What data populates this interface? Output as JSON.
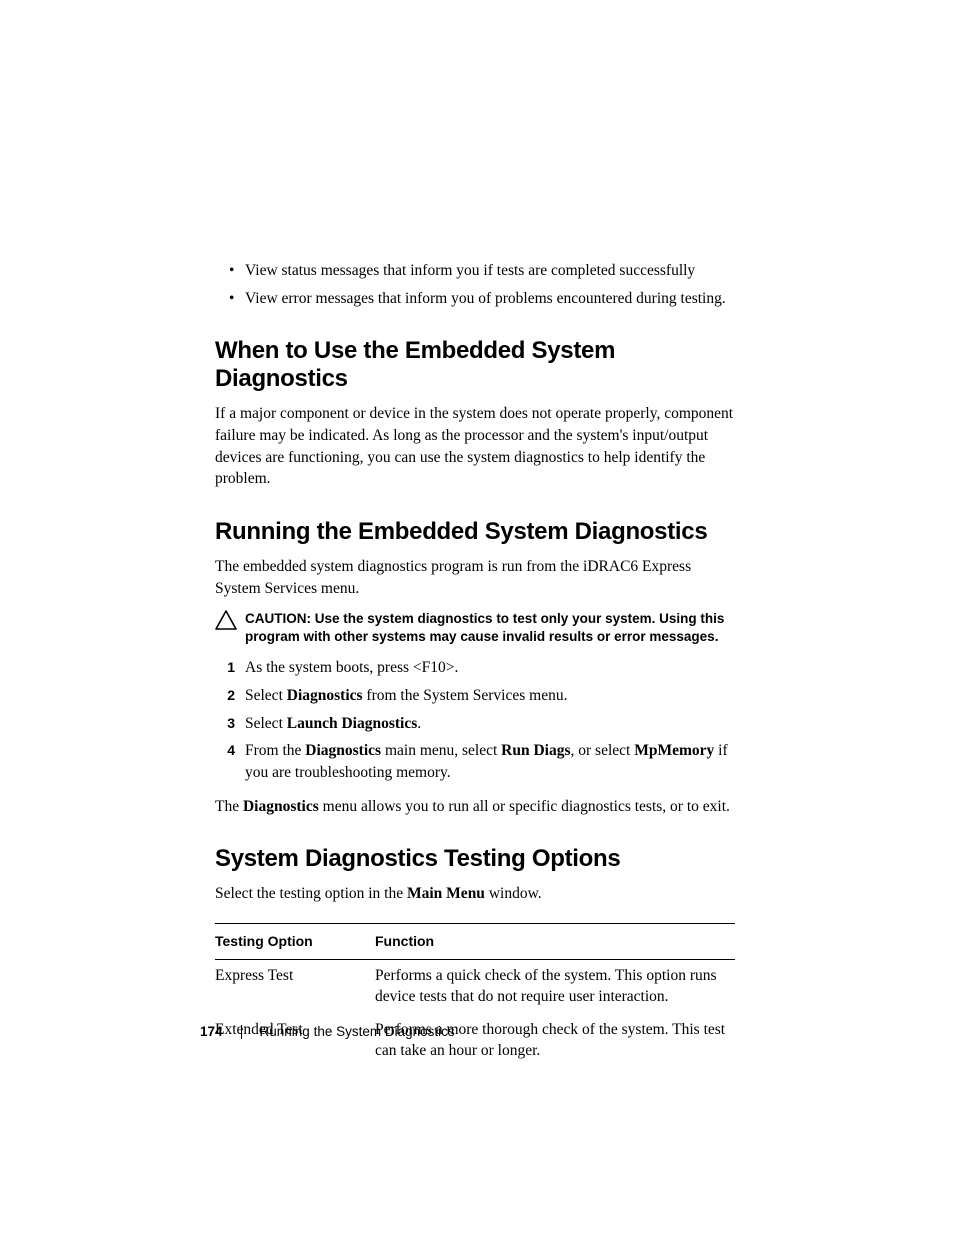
{
  "top_bullets": [
    "View status messages that inform you if tests are completed successfully",
    "View error messages that inform you of problems encountered during testing."
  ],
  "sec1": {
    "heading": "When to Use the Embedded System Diagnostics",
    "para": "If a major component or device in the system does not operate properly, component failure may be indicated. As long as the processor and the system's input/output devices are functioning, you can use the system diagnostics to help identify the problem."
  },
  "sec2": {
    "heading": "Running the Embedded System Diagnostics",
    "intro": "The embedded system diagnostics program is run from the iDRAC6 Express System Services menu.",
    "caution_label": "CAUTION: ",
    "caution_text": "Use the system diagnostics to test only your system. Using this program with other systems may cause invalid results or error messages.",
    "steps": {
      "n1": "1",
      "s1_a": "As the system boots, press <F10>.",
      "n2": "2",
      "s2_a": "Select ",
      "s2_b": "Diagnostics",
      "s2_c": " from the System Services menu.",
      "n3": "3",
      "s3_a": "Select ",
      "s3_b": "Launch Diagnostics",
      "s3_c": ".",
      "n4": "4",
      "s4_a": "From the ",
      "s4_b": "Diagnostics",
      "s4_c": " main menu, select ",
      "s4_d": "Run Diags",
      "s4_e": ", or select ",
      "s4_f": "MpMemory",
      "s4_g": " if you are troubleshooting memory."
    },
    "after_a": "The ",
    "after_b": "Diagnostics",
    "after_c": " menu allows you to run all or specific diagnostics tests, or to exit."
  },
  "sec3": {
    "heading": "System Diagnostics Testing Options",
    "intro_a": "Select the testing option in the ",
    "intro_b": "Main Menu",
    "intro_c": " window.",
    "th1": "Testing Option",
    "th2": "Function",
    "rows": [
      {
        "option": "Express Test",
        "func": "Performs a quick check of the system. This option runs device tests that do not require user interaction."
      },
      {
        "option": "Extended Test",
        "func": "Performs a more thorough check of the system. This test can take an hour or longer."
      }
    ]
  },
  "footer": {
    "page": "174",
    "title": "Running the System Diagnostics"
  }
}
